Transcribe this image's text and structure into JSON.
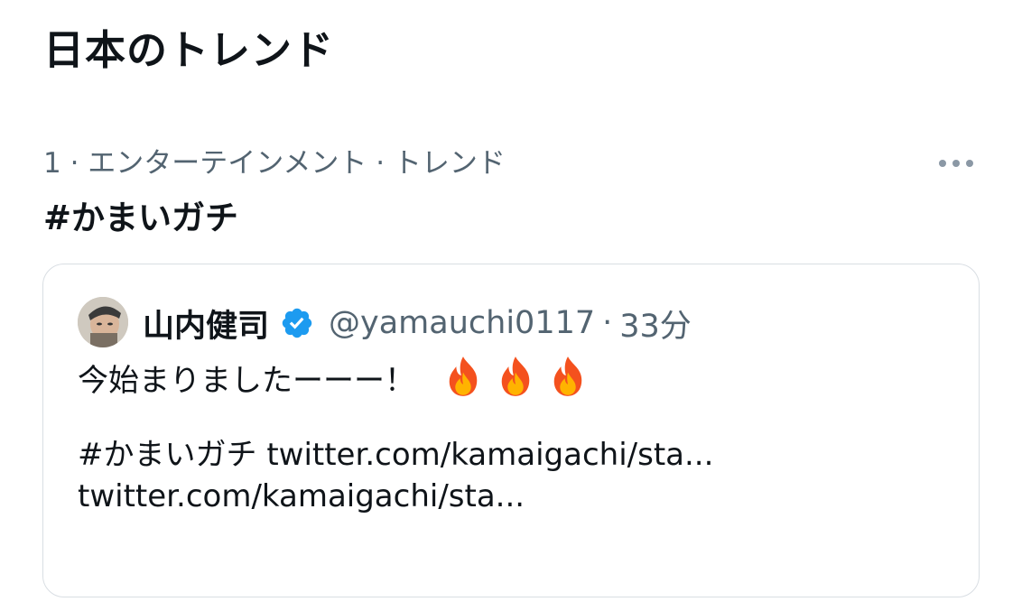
{
  "section": {
    "title": "日本のトレンド"
  },
  "trend": {
    "meta": "1 · エンターテインメント · トレンド",
    "name": "#かまいガチ",
    "more_icon": "more-horizontal-icon"
  },
  "tweet": {
    "author_name": "山内健司",
    "verified_icon": "verified-badge-icon",
    "handle": "@yamauchi0117",
    "separator": "·",
    "time": "33分",
    "text_line1": "今始まりましたーーー！",
    "fire_icons": [
      "fire-icon",
      "fire-icon",
      "fire-icon"
    ],
    "hashtag": "#かまいガチ",
    "link1": "twitter.com/kamaigachi/sta...",
    "link2": "twitter.com/kamaigachi/sta..."
  },
  "colors": {
    "text_primary": "#0f1419",
    "text_secondary": "#536471",
    "verified_blue": "#1d9bf0",
    "border": "#d9dee3"
  }
}
